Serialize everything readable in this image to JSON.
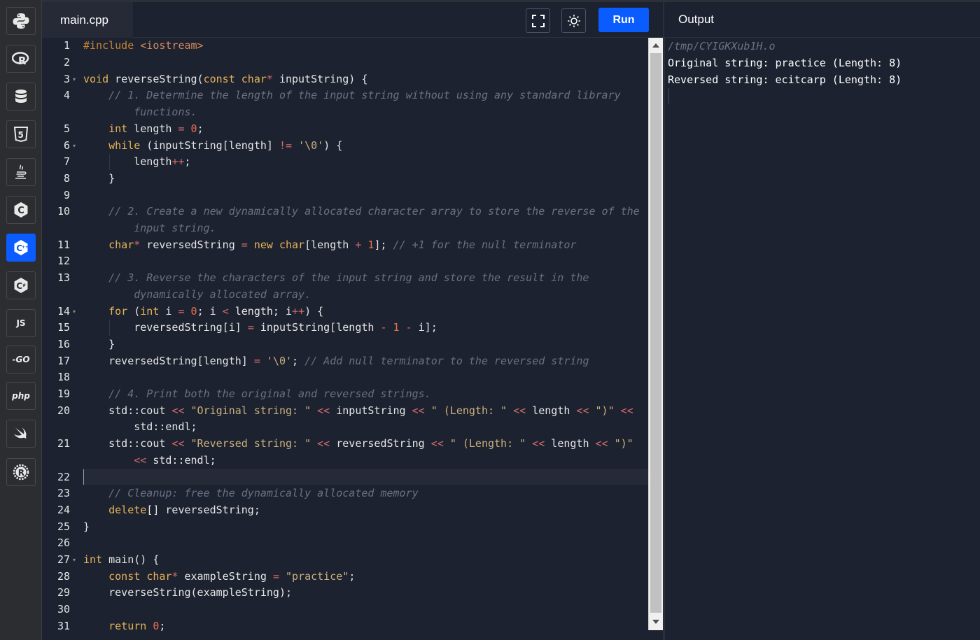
{
  "sidebar": {
    "languages": [
      {
        "name": "python",
        "icon": "python-icon"
      },
      {
        "name": "r",
        "icon": "r-icon"
      },
      {
        "name": "sql",
        "icon": "database-icon"
      },
      {
        "name": "html",
        "icon": "html5-icon"
      },
      {
        "name": "java",
        "icon": "java-icon"
      },
      {
        "name": "c",
        "icon": "c-icon"
      },
      {
        "name": "cpp",
        "icon": "cpp-icon",
        "active": true
      },
      {
        "name": "csharp",
        "icon": "csharp-icon"
      },
      {
        "name": "javascript",
        "label": "JS"
      },
      {
        "name": "go",
        "label": "-GO"
      },
      {
        "name": "php",
        "label": "php"
      },
      {
        "name": "swift",
        "icon": "swift-icon"
      },
      {
        "name": "rust",
        "icon": "rust-icon"
      }
    ]
  },
  "editor": {
    "file_name": "main.cpp",
    "run_label": "Run",
    "active_line": 22
  },
  "output": {
    "title": "Output",
    "lines": [
      "/tmp/CYIGKXub1H.o",
      "Original string: practice (Length: 8)",
      "Reversed string: ecitcarp (Length: 8)"
    ]
  },
  "colors": {
    "accent": "#0b5cff",
    "background": "#1d2230",
    "keyword": "#e6b455",
    "string": "#c9b17a",
    "number": "#e8704a",
    "comment": "#6b7180"
  }
}
